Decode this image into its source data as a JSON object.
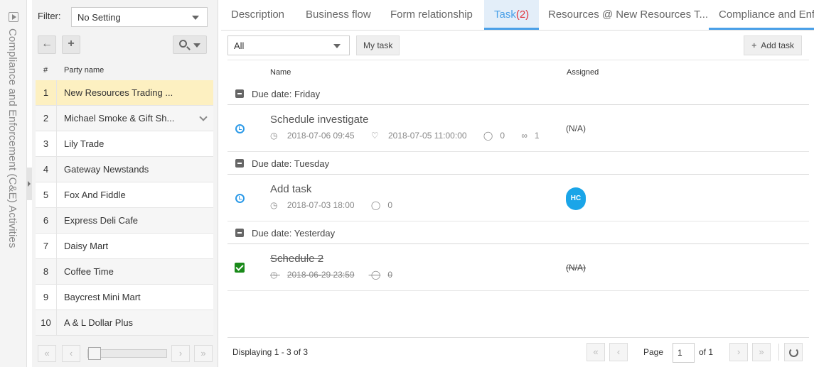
{
  "side_strip": {
    "title": "Compliance and Enforcement (C&E) Activities"
  },
  "left_panel": {
    "filter_label": "Filter:",
    "filter_value": "No Setting",
    "columns": [
      "#",
      "Party name"
    ],
    "parties": [
      {
        "num": "1",
        "name": "New Resources Trading ..."
      },
      {
        "num": "2",
        "name": "Michael Smoke & Gift Sh..."
      },
      {
        "num": "3",
        "name": "Lily Trade"
      },
      {
        "num": "4",
        "name": "Gateway Newstands"
      },
      {
        "num": "5",
        "name": "Fox And Fiddle"
      },
      {
        "num": "6",
        "name": "Express Deli Cafe"
      },
      {
        "num": "7",
        "name": "Daisy Mart"
      },
      {
        "num": "8",
        "name": "Coffee Time"
      },
      {
        "num": "9",
        "name": "Baycrest Mini Mart"
      },
      {
        "num": "10",
        "name": "A & L Dollar Plus"
      }
    ],
    "selected_index": 0
  },
  "tabs": [
    {
      "label": "Description"
    },
    {
      "label": "Business flow"
    },
    {
      "label": "Form relationship"
    },
    {
      "label": "Task",
      "count": "(2)"
    },
    {
      "label": "Resources @ New Resources T..."
    },
    {
      "label": "Compliance and Enfo"
    }
  ],
  "active_tab": 3,
  "toolbar": {
    "filter_value": "All",
    "my_task_label": "My task",
    "add_task_label": "Add task"
  },
  "grid": {
    "col_name": "Name",
    "col_assigned": "Assigned",
    "groups": [
      {
        "title": "Due date: Friday",
        "task": {
          "title": "Schedule investigate",
          "due": "2018-07-06 09:45",
          "reminder": "2018-07-05 11:00:00",
          "comments": "0",
          "attachments": "1",
          "assigned": "(N/A)",
          "status": "open"
        }
      },
      {
        "title": "Due date: Tuesday",
        "task": {
          "title": "Add task",
          "due": "2018-07-03 18:00",
          "comments": "0",
          "assigned_initials": "HC",
          "status": "open"
        }
      },
      {
        "title": "Due date: Yesterday",
        "task": {
          "title": "Schedule 2",
          "due": "2018-06-29 23:59",
          "comments": "0",
          "assigned": "(N/A)",
          "status": "done"
        }
      }
    ],
    "footer": {
      "displaying": "Displaying 1 - 3 of 3",
      "page_label": "Page",
      "page_value": "1",
      "of_label": "of 1"
    }
  },
  "colors": {
    "accent": "#4aa0e8",
    "selected_row": "#fdf0c1",
    "badge_red": "#e0343d",
    "done_green": "#1a8a1a",
    "avatar": "#1aa5e8"
  }
}
